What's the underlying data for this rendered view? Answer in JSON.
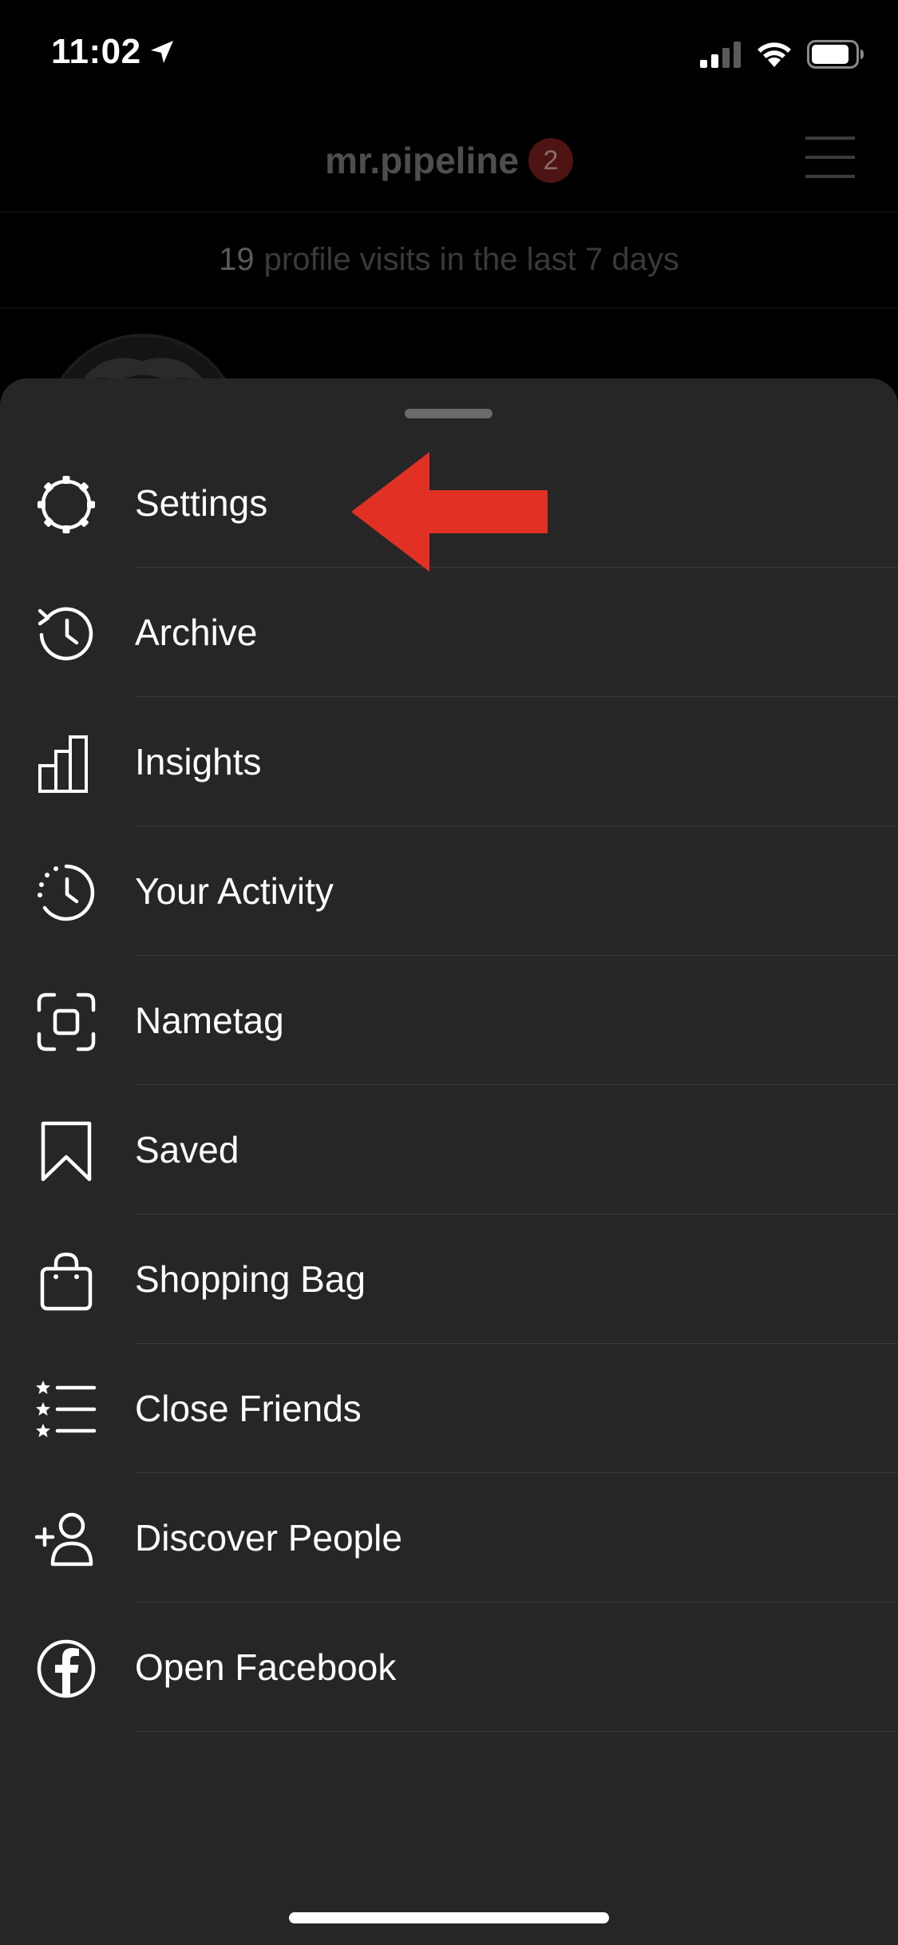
{
  "status_bar": {
    "time": "11:02",
    "location_icon": "location-arrow-icon",
    "signal_icon": "cellular-signal-icon",
    "wifi_icon": "wifi-icon",
    "battery_icon": "battery-icon"
  },
  "profile": {
    "username": "mr.pipeline",
    "notification_count": "2",
    "visits_count": "19",
    "visits_text": "profile visits in the last 7 days"
  },
  "colors": {
    "sheet_background": "#262626",
    "divider": "#3a3a3a",
    "annotation_arrow": "#e03124",
    "badge": "#4e1414"
  },
  "menu": {
    "items": [
      {
        "label": "Settings",
        "icon": "settings-gear-icon"
      },
      {
        "label": "Archive",
        "icon": "archive-clock-icon"
      },
      {
        "label": "Insights",
        "icon": "insights-bar-chart-icon"
      },
      {
        "label": "Your Activity",
        "icon": "activity-clock-icon"
      },
      {
        "label": "Nametag",
        "icon": "nametag-scan-icon"
      },
      {
        "label": "Saved",
        "icon": "bookmark-icon"
      },
      {
        "label": "Shopping Bag",
        "icon": "shopping-bag-icon"
      },
      {
        "label": "Close Friends",
        "icon": "close-friends-star-list-icon"
      },
      {
        "label": "Discover People",
        "icon": "add-person-icon"
      },
      {
        "label": "Open Facebook",
        "icon": "facebook-icon"
      }
    ]
  }
}
